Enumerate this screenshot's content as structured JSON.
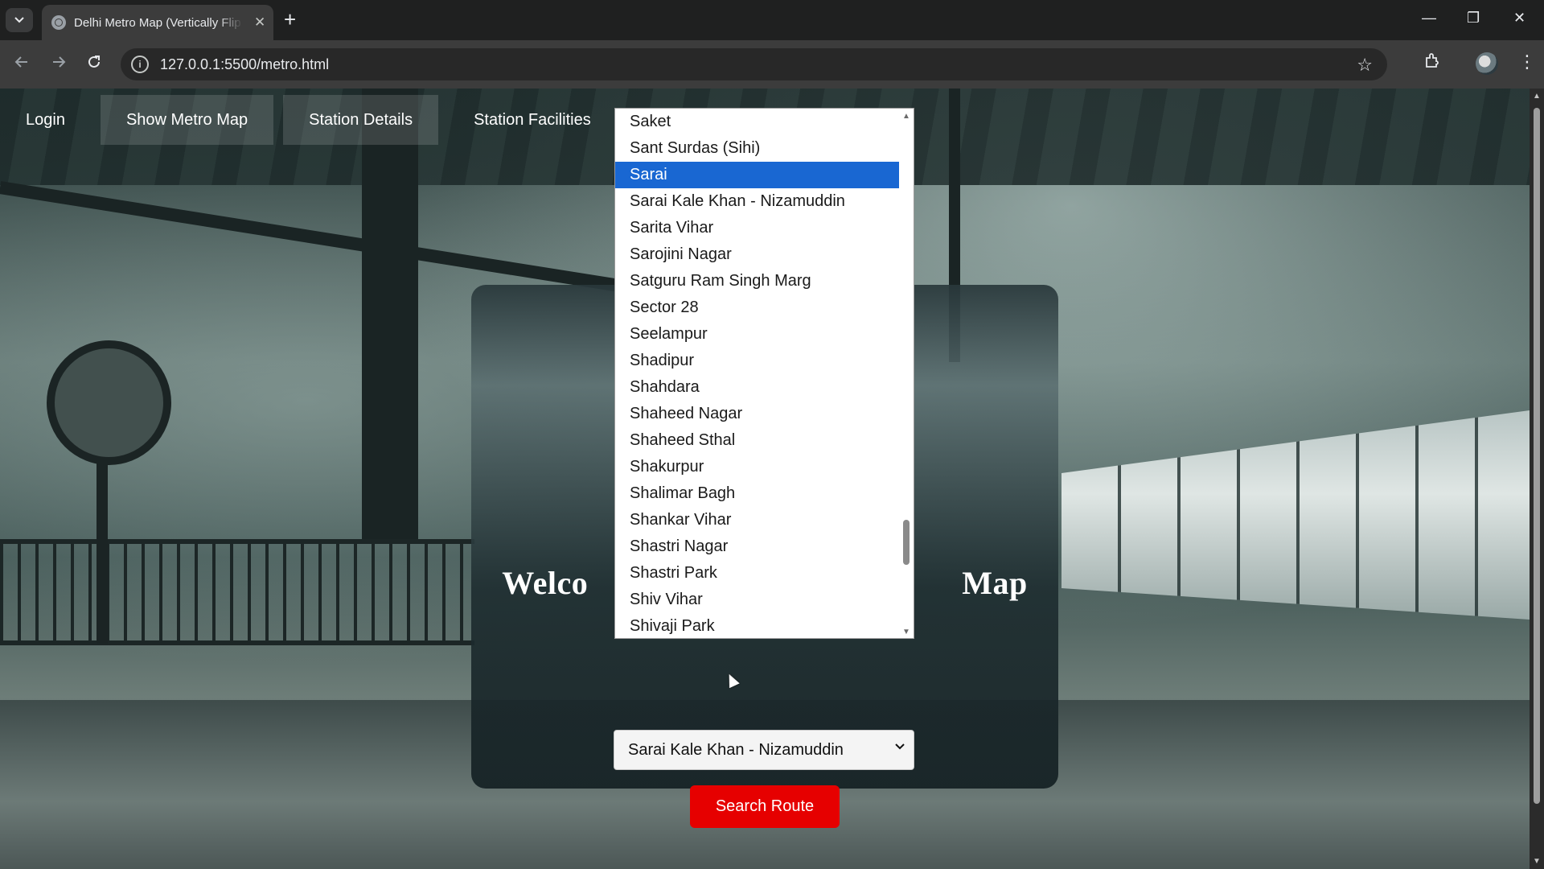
{
  "browser": {
    "tab_title": "Delhi Metro Map (Vertically Flip",
    "tab_close": "✕",
    "new_tab": "+",
    "url": "127.0.0.1:5500/metro.html",
    "window_controls": {
      "minimize": "—",
      "restore": "❐",
      "close": "✕"
    }
  },
  "nav": {
    "items": [
      {
        "label": "Login"
      },
      {
        "label": "Show Metro Map"
      },
      {
        "label": "Station Details"
      },
      {
        "label": "Station Facilities"
      }
    ]
  },
  "card": {
    "title_left": "Welco",
    "title_right": "Map"
  },
  "dropdown": {
    "options": [
      "Saket",
      "Sant Surdas (Sihi)",
      "Sarai",
      "Sarai Kale Khan - Nizamuddin",
      "Sarita Vihar",
      "Sarojini Nagar",
      "Satguru Ram Singh Marg",
      "Sector 28",
      "Seelampur",
      "Shadipur",
      "Shahdara",
      "Shaheed Nagar",
      "Shaheed Sthal",
      "Shakurpur",
      "Shalimar Bagh",
      "Shankar Vihar",
      "Shastri Nagar",
      "Shastri Park",
      "Shiv Vihar",
      "Shivaji Park"
    ],
    "highlighted": "Sarai"
  },
  "to_select": {
    "value": "Sarai Kale Khan - Nizamuddin"
  },
  "search_button": {
    "label": "Search Route"
  },
  "colors": {
    "highlight": "#1967d2",
    "search_button": "#e60000"
  }
}
